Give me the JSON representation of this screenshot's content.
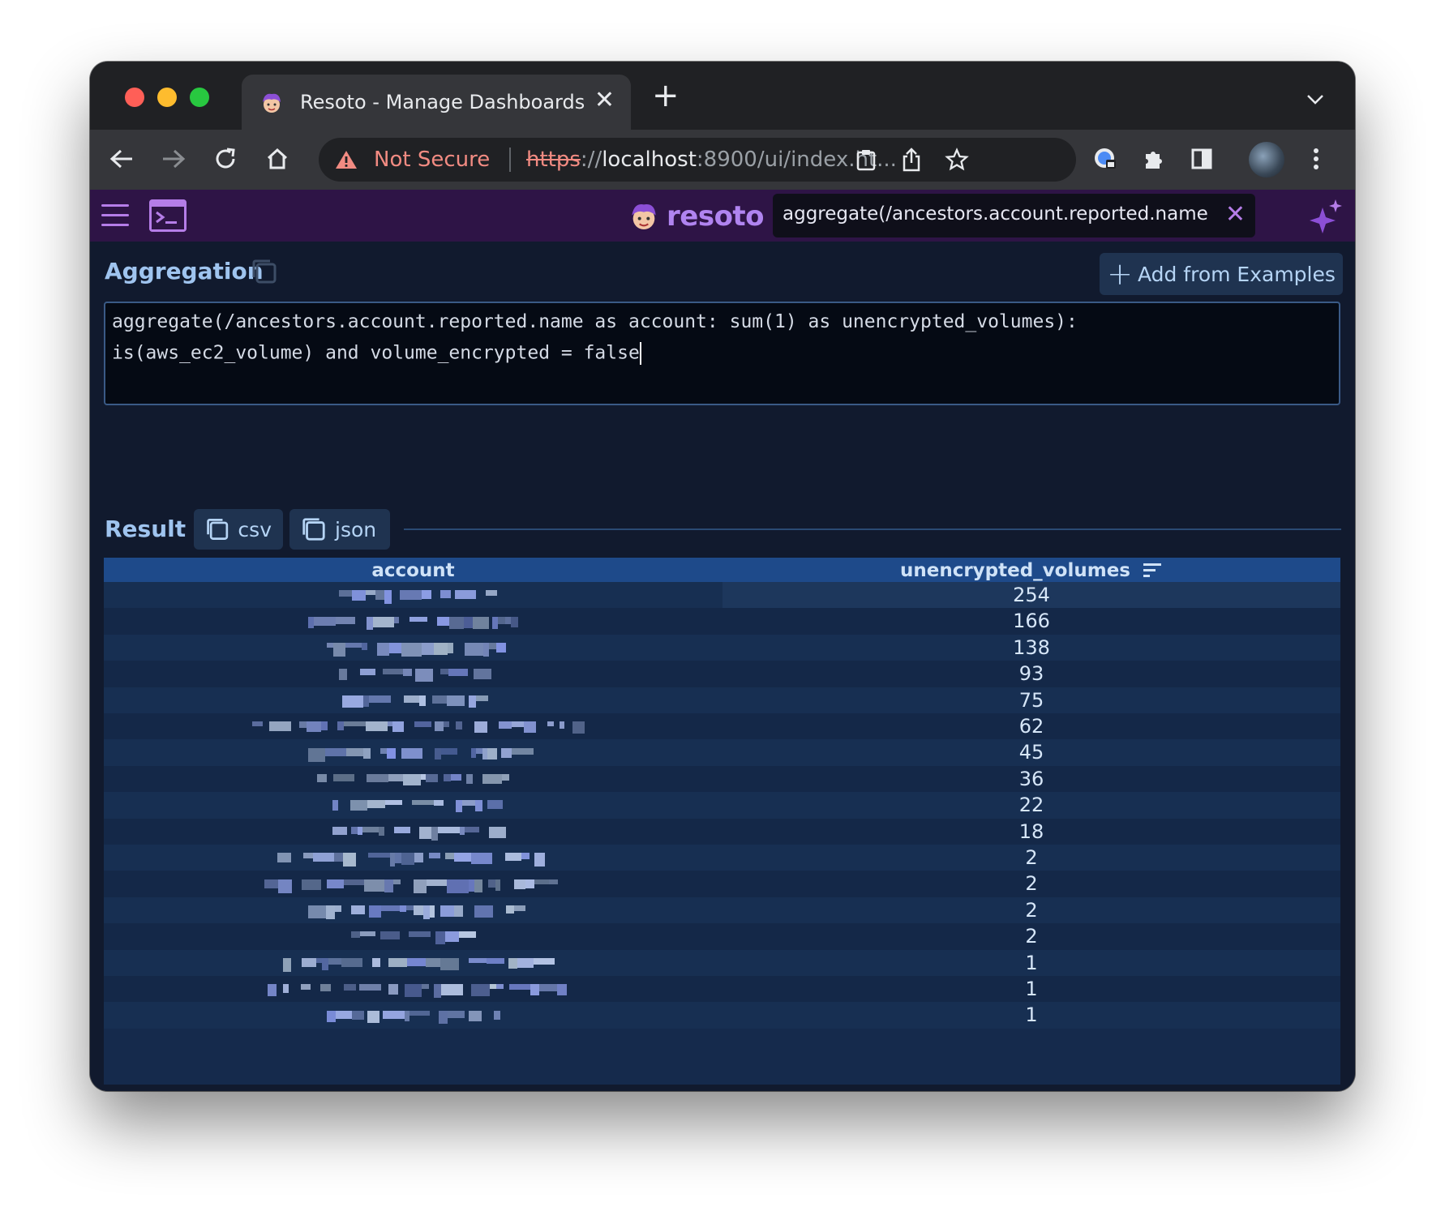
{
  "browser": {
    "tab_title": "Resoto - Manage Dashboards",
    "security_label": "Not Secure",
    "url_scheme": "https",
    "url_sep": "://",
    "url_host": "localhost",
    "url_rest": ":8900/ui/index.ht...",
    "icons": [
      "back-icon",
      "forward-icon",
      "reload-icon",
      "home-icon",
      "warning-icon",
      "clipboard-icon",
      "share-icon",
      "star-icon",
      "password-manager-icon",
      "extensions-icon",
      "sidebar-icon",
      "more-icon"
    ]
  },
  "app": {
    "logo_text": "resoto",
    "search_value": "aggregate(/ancestors.account.reported.name as acc",
    "accent_color": "#b57de8"
  },
  "aggregation": {
    "title": "Aggregation",
    "add_button_label": "Add from Examples",
    "code_line_1": "aggregate(/ancestors.account.reported.name as account: sum(1) as unencrypted_volumes):",
    "code_line_2": "is(aws_ec2_volume) and volume_encrypted = false"
  },
  "result": {
    "title": "Result",
    "csv_label": "csv",
    "json_label": "json",
    "columns": [
      "account",
      "unencrypted_volumes"
    ],
    "rows": [
      {
        "account": "",
        "unencrypted_volumes": "254"
      },
      {
        "account": "",
        "unencrypted_volumes": "166"
      },
      {
        "account": "",
        "unencrypted_volumes": "138"
      },
      {
        "account": "",
        "unencrypted_volumes": "93"
      },
      {
        "account": "",
        "unencrypted_volumes": "75"
      },
      {
        "account": "",
        "unencrypted_volumes": "62"
      },
      {
        "account": "",
        "unencrypted_volumes": "45"
      },
      {
        "account": "",
        "unencrypted_volumes": "36"
      },
      {
        "account": "",
        "unencrypted_volumes": "22"
      },
      {
        "account": "",
        "unencrypted_volumes": "18"
      },
      {
        "account": "",
        "unencrypted_volumes": "2"
      },
      {
        "account": "",
        "unencrypted_volumes": "2"
      },
      {
        "account": "",
        "unencrypted_volumes": "2"
      },
      {
        "account": "",
        "unencrypted_volumes": "2"
      },
      {
        "account": "",
        "unencrypted_volumes": "1"
      },
      {
        "account": "",
        "unencrypted_volumes": "1"
      },
      {
        "account": "",
        "unencrypted_volumes": "1"
      }
    ]
  }
}
